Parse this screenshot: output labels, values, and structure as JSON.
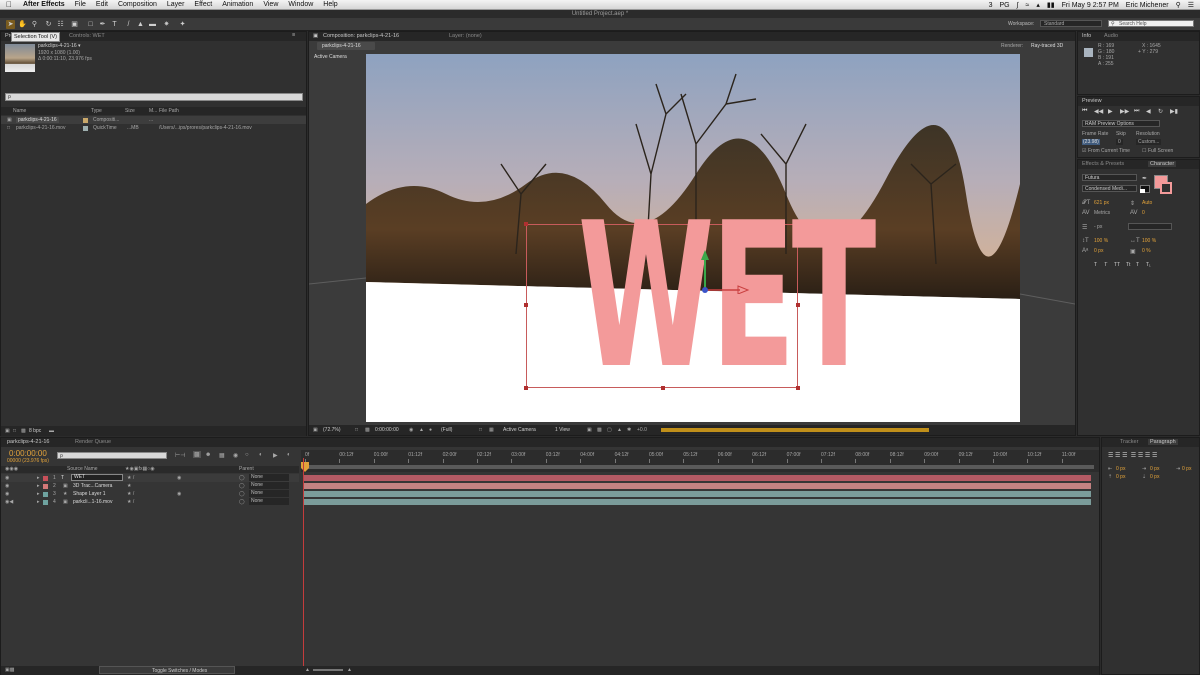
{
  "menubar": {
    "app_name": "After Effects",
    "items": [
      "File",
      "Edit",
      "Composition",
      "Layer",
      "Effect",
      "Animation",
      "View",
      "Window",
      "Help"
    ],
    "right_status": "3",
    "user_initials": "PG",
    "datetime": "Fri May 9  2:57 PM",
    "user_name": "Eric Michener"
  },
  "window_title": "Untitled Project.aep *",
  "toolbar": {
    "tooltip": "Selection Tool (V)",
    "workspace_label": "Workspace:",
    "workspace_value": "Standard",
    "search_placeholder": "Search Help"
  },
  "project_panel": {
    "tab_label": "Project",
    "controls_tab": "Controls: WET",
    "thumb_name": "parkclips-4-21-16 ▾",
    "thumb_res": "1920 x 1080 (1.00)",
    "thumb_dur": "Δ 0:00:11:10, 23.976 fps",
    "search_placeholder": "ρ",
    "columns": [
      "Name",
      "Type",
      "Size",
      "M...",
      "File Path"
    ],
    "items": [
      {
        "name": "parkclips-4-21-16",
        "type": "Compositi...",
        "size": "",
        "media": "...",
        "path": ""
      },
      {
        "name": "parkclips-4-21-16.mov",
        "type": "QuickTime",
        "size": "...MB",
        "media": "",
        "path": "/Users/...ips/prores/parkclips-4-21-16.mov"
      }
    ],
    "bpc": "8 bpc"
  },
  "comp_panel": {
    "tab_label": "Composition: parkclips-4-21-16",
    "layer_tab": "Layer: (none)",
    "sub_tab": "parkclips-4-21-16",
    "renderer_label": "Renderer:",
    "renderer_value": "Ray-traced 3D",
    "camera_label": "Active Camera",
    "text_layer": "WET",
    "zoom": "(72.7%)",
    "time": "0:00:00:00",
    "resolution": "(Full)",
    "view_camera": "Active Camera",
    "view_count": "1 View",
    "exposure": "+0.0"
  },
  "info_panel": {
    "tab_info": "Info",
    "tab_audio": "Audio",
    "r": "R : 169",
    "g": "G : 180",
    "b": "B : 191",
    "a": "A : 255",
    "x": "X : 1645",
    "y": "+ Y : 279"
  },
  "preview_panel": {
    "tab": "Preview",
    "ram_options": "RAM Preview Options",
    "frame_rate_label": "Frame Rate",
    "skip_label": "Skip",
    "resolution_label": "Resolution",
    "frame_rate_value": "(23.98)",
    "skip_value": "0",
    "resolution_value": "Custom...",
    "from_current": "From Current Time",
    "full_screen": "Full Screen"
  },
  "character_panel": {
    "tab_effects": "Effects & Presets",
    "tab_character": "Character",
    "font": "Futura",
    "style": "Condensed Medi...",
    "size": "621 px",
    "leading": "Auto",
    "kerning": "Metrics",
    "tracking": "0",
    "stroke": "- px",
    "vscale": "100 %",
    "hscale": "100 %",
    "baseline": "0 px",
    "tsume": "0 %",
    "styles": [
      "T",
      "T",
      "TT",
      "Tt",
      "T",
      "T₁"
    ],
    "fill_color": "#f39a9a"
  },
  "paragraph_panel": {
    "tab_tracker": "Tracker",
    "tab_paragraph": "Paragraph",
    "values": [
      "0 px",
      "0 px",
      "0 px",
      "0 px",
      "0 px"
    ]
  },
  "timeline": {
    "tab_comp": "parkclips-4-21-16",
    "tab_render": "Render Queue",
    "timecode": "0:00:00:00",
    "frames": "00000 (23.976 fps)",
    "search_placeholder": "ρ",
    "col_source": "Source Name",
    "col_parent": "Parent",
    "ruler": [
      "0f",
      "00:12f",
      "01:00f",
      "01:12f",
      "02:00f",
      "02:12f",
      "03:00f",
      "03:12f",
      "04:00f",
      "04:12f",
      "05:00f",
      "05:12f",
      "06:00f",
      "06:12f",
      "07:00f",
      "07:12f",
      "08:00f",
      "08:12f",
      "09:00f",
      "09:12f",
      "10:00f",
      "10:12f",
      "11:00f"
    ],
    "layers": [
      {
        "num": "1",
        "name": "WET",
        "parent": "None",
        "color": "#c8505a",
        "bar": "#b45a64"
      },
      {
        "num": "2",
        "name": "3D Trac...Camera",
        "parent": "None",
        "color": "#d27878",
        "bar": "#c38282"
      },
      {
        "num": "3",
        "name": "Shape Layer 1",
        "parent": "None",
        "color": "#6fa3a0",
        "bar": "#7b9c9a"
      },
      {
        "num": "4",
        "name": "parkcli...1-16.mov",
        "parent": "None",
        "color": "#6fa3a0",
        "bar": "#7b9c9a"
      }
    ],
    "toggle_label": "Toggle Switches / Modes"
  }
}
